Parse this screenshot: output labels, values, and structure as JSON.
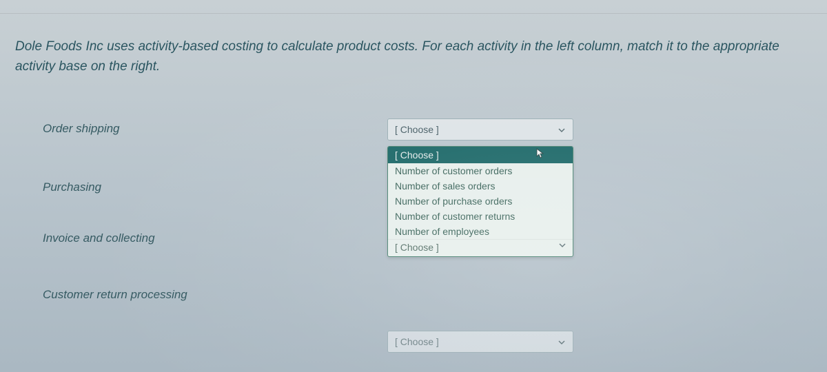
{
  "question": {
    "text": "Dole Foods Inc uses activity-based costing to calculate product costs.  For each activity in the left column, match it to the appropriate activity base on the right."
  },
  "activities": [
    {
      "label": "Order shipping"
    },
    {
      "label": "Purchasing"
    },
    {
      "label": "Invoice and collecting"
    },
    {
      "label": "Customer return processing"
    }
  ],
  "select_placeholder": "[ Choose ]",
  "dropdown": {
    "header": "[ Choose ]",
    "options": [
      "Number of customer orders",
      "Number of sales orders",
      "Number of purchase orders",
      "Number of customer returns",
      "Number of employees"
    ],
    "footer": "[ Choose ]"
  }
}
